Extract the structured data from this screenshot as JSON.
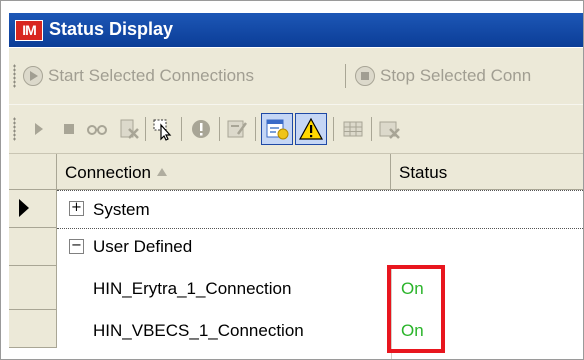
{
  "window": {
    "app_icon_label": "IM",
    "title": "Status Display"
  },
  "toolbar1": {
    "start_label": "Start Selected Connections",
    "stop_label": "Stop Selected Conn"
  },
  "toolbar2": {
    "icons": [
      "play-icon",
      "stop-icon",
      "glasses-icon",
      "document-delete-icon",
      "pointer-select-icon",
      "alert-circle-icon",
      "edit-document-icon",
      "properties-icon",
      "warning-icon",
      "grid-icon",
      "delete-icon"
    ]
  },
  "grid": {
    "columns": [
      "Connection",
      "Status"
    ],
    "groups": [
      {
        "label": "System",
        "expander": "+"
      },
      {
        "label": "User Defined",
        "expander": "−"
      }
    ],
    "rows": [
      {
        "name": "HIN_Erytra_1_Connection",
        "status": "On"
      },
      {
        "name": "HIN_VBECS_1_Connection",
        "status": "On"
      }
    ]
  },
  "colors": {
    "title_bar": "#0b3d97",
    "status_on": "#2ab42a",
    "highlight_box": "#e8161e"
  }
}
